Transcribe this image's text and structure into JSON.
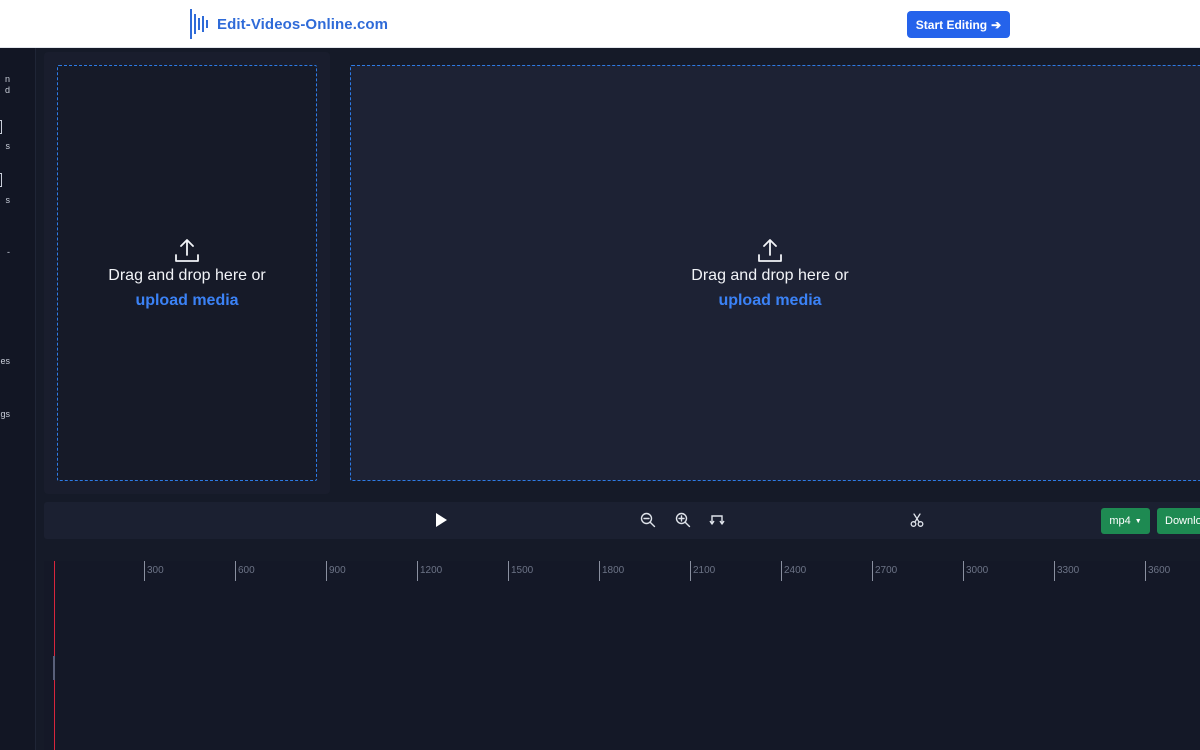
{
  "header": {
    "logo_text": "Edit-Videos-Online.com",
    "start_button_label": "Start Editing",
    "start_button_arrow": "➔"
  },
  "sidebar": {
    "items": [
      {
        "label": "n\nd",
        "icon": "upload-icon"
      },
      {
        "label": "s",
        "icon": "text-icon"
      },
      {
        "label": "s",
        "icon": "images-icon"
      },
      {
        "label": "-",
        "icon": "audio-icon"
      },
      {
        "label": "es",
        "icon": "shapes-icon"
      },
      {
        "label": "gs",
        "icon": "settings-icon"
      }
    ]
  },
  "media_panel": {
    "drop_text": "Drag and drop here or",
    "upload_link": "upload media"
  },
  "preview": {
    "drop_text": "Drag and drop here or",
    "upload_link": "upload media"
  },
  "toolbar": {
    "play_icon": "play-icon",
    "zoom_out_icon": "zoom-out-icon",
    "zoom_in_icon": "zoom-in-icon",
    "fit_icon": "fit-icon",
    "cut_icon": "scissors-icon",
    "format_label": "mp4",
    "download_label": "Downlo"
  },
  "timeline": {
    "ticks": [
      "300",
      "600",
      "900",
      "1200",
      "1500",
      "1800",
      "2100",
      "2400",
      "2700",
      "3000",
      "3300",
      "3600"
    ]
  },
  "colors": {
    "accent": "#2563eb",
    "link": "#3b82f6",
    "success": "#1e8a52",
    "playhead": "#d7263d",
    "background": "#151a28"
  }
}
